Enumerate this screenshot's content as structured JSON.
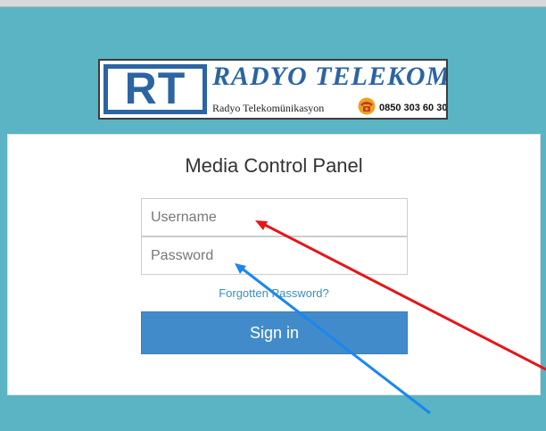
{
  "logo": {
    "initials": "RT",
    "name": "RADYO TELEKOM",
    "subtitle": "Radyo Telekomünikasyon",
    "phone": "0850 303 60 30",
    "phone_icon": "telephone-icon"
  },
  "panel": {
    "title": "Media Control Panel",
    "username_placeholder": "Username",
    "username_value": "",
    "password_placeholder": "Password",
    "password_value": "",
    "forgot_link": "Forgotten Password?",
    "signin_label": "Sign in"
  },
  "annotations": [
    {
      "name": "annotation-arrow-red",
      "color": "#e8141a"
    },
    {
      "name": "annotation-arrow-blue",
      "color": "#1b86f0"
    }
  ],
  "colors": {
    "background": "#5ab4c4",
    "logo_blue": "#2c64a4",
    "button": "#428bca",
    "link": "#3c8dbc"
  }
}
